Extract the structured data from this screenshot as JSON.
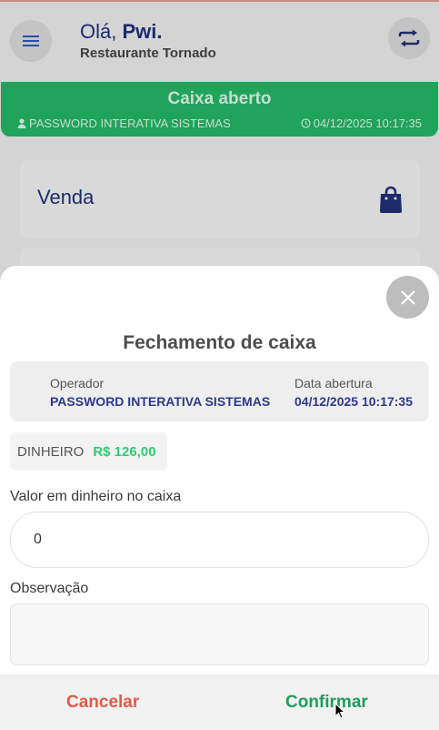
{
  "header": {
    "greeting_prefix": "Olá, ",
    "user_name": "Pwi.",
    "restaurant": "Restaurante Tornado"
  },
  "status": {
    "title": "Caixa aberto",
    "operator": "PASSWORD INTERATIVA SISTEMAS",
    "datetime": "04/12/2025 10:17:35"
  },
  "cards": {
    "venda_label": "Venda"
  },
  "dialog": {
    "title": "Fechamento de caixa",
    "operator_label": "Operador",
    "operator_value": "PASSWORD INTERATIVA SISTEMAS",
    "date_label": "Data abertura",
    "date_value": "04/12/2025 10:17:35",
    "cash_type": "DINHEIRO",
    "cash_amount": "R$ 126,00",
    "valor_label": "Valor em dinheiro no caixa",
    "valor_value": "0",
    "obs_label": "Observação",
    "obs_value": "",
    "cancel_label": "Cancelar",
    "confirm_label": "Confirmar"
  },
  "icons": {
    "menu": "menu-icon",
    "swap": "swap-icon",
    "user": "user-icon",
    "clock": "clock-icon",
    "bag": "shopping-bag-icon",
    "close": "close-icon"
  },
  "colors": {
    "status_green": "#20a35b",
    "navy": "#1d2b6b",
    "cash_green": "#2ecc71",
    "cancel_red": "#e05a4a",
    "confirm_green": "#1e9d5a"
  }
}
